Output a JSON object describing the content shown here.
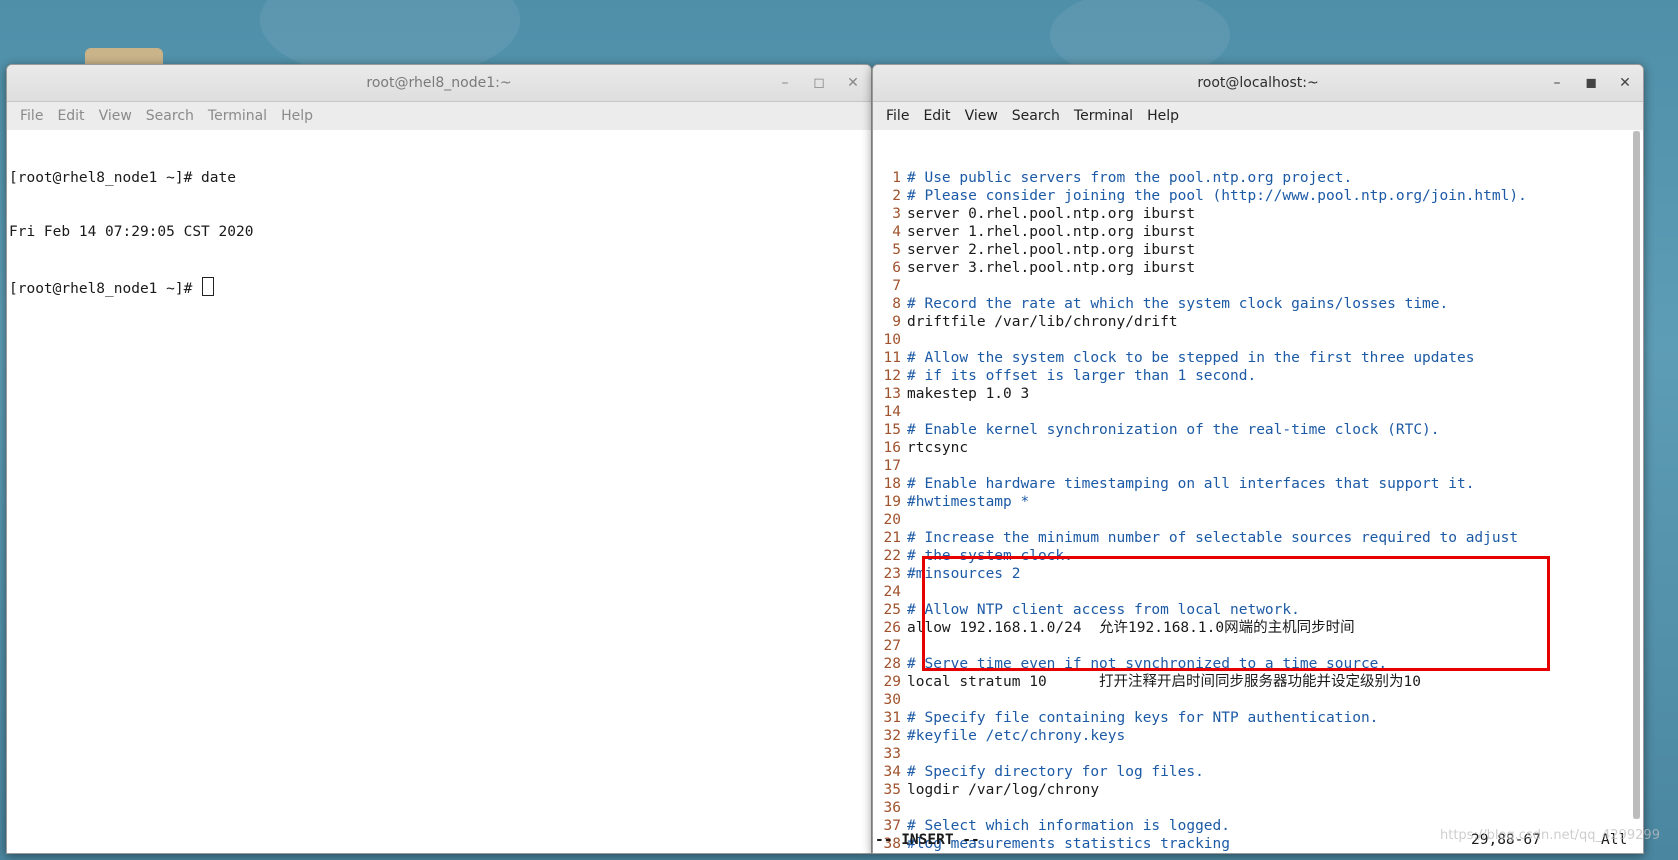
{
  "left_window": {
    "title": "root@rhel8_node1:~",
    "menu": [
      "File",
      "Edit",
      "View",
      "Search",
      "Terminal",
      "Help"
    ],
    "lines": [
      "[root@rhel8_node1 ~]# date",
      "Fri Feb 14 07:29:05 CST 2020"
    ],
    "prompt": "[root@rhel8_node1 ~]# "
  },
  "right_window": {
    "title": "root@localhost:~",
    "menu": [
      "File",
      "Edit",
      "View",
      "Search",
      "Terminal",
      "Help"
    ],
    "lines": [
      {
        "n": "1",
        "t": "# Use public servers from the pool.ntp.org project.",
        "comment": true
      },
      {
        "n": "2",
        "t": "# Please consider joining the pool (http://www.pool.ntp.org/join.html).",
        "comment": true
      },
      {
        "n": "3",
        "t": "server 0.rhel.pool.ntp.org iburst",
        "comment": false
      },
      {
        "n": "4",
        "t": "server 1.rhel.pool.ntp.org iburst",
        "comment": false
      },
      {
        "n": "5",
        "t": "server 2.rhel.pool.ntp.org iburst",
        "comment": false
      },
      {
        "n": "6",
        "t": "server 3.rhel.pool.ntp.org iburst",
        "comment": false
      },
      {
        "n": "7",
        "t": "",
        "comment": false
      },
      {
        "n": "8",
        "t": "# Record the rate at which the system clock gains/losses time.",
        "comment": true
      },
      {
        "n": "9",
        "t": "driftfile /var/lib/chrony/drift",
        "comment": false
      },
      {
        "n": "10",
        "t": "",
        "comment": false
      },
      {
        "n": "11",
        "t": "# Allow the system clock to be stepped in the first three updates",
        "comment": true
      },
      {
        "n": "12",
        "t": "# if its offset is larger than 1 second.",
        "comment": true
      },
      {
        "n": "13",
        "t": "makestep 1.0 3",
        "comment": false
      },
      {
        "n": "14",
        "t": "",
        "comment": false
      },
      {
        "n": "15",
        "t": "# Enable kernel synchronization of the real-time clock (RTC).",
        "comment": true
      },
      {
        "n": "16",
        "t": "rtcsync",
        "comment": false
      },
      {
        "n": "17",
        "t": "",
        "comment": false
      },
      {
        "n": "18",
        "t": "# Enable hardware timestamping on all interfaces that support it.",
        "comment": true
      },
      {
        "n": "19",
        "t": "#hwtimestamp *",
        "comment": true
      },
      {
        "n": "20",
        "t": "",
        "comment": false
      },
      {
        "n": "21",
        "t": "# Increase the minimum number of selectable sources required to adjust",
        "comment": true
      },
      {
        "n": "22",
        "t": "# the system clock.",
        "comment": true
      },
      {
        "n": "23",
        "t": "#minsources 2",
        "comment": true
      },
      {
        "n": "24",
        "t": "",
        "comment": false
      },
      {
        "n": "25",
        "t": "# Allow NTP client access from local network.",
        "comment": true
      },
      {
        "n": "26",
        "t": "allow 192.168.1.0/24  允许192.168.1.0网端的主机同步时间",
        "comment": false
      },
      {
        "n": "27",
        "t": "",
        "comment": false
      },
      {
        "n": "28",
        "t": "# Serve time even if not synchronized to a time source.",
        "comment": true
      },
      {
        "n": "29",
        "t": "local stratum 10      打开注释开启时间同步服务器功能并设定级别为10",
        "comment": false
      },
      {
        "n": "30",
        "t": "",
        "comment": false
      },
      {
        "n": "31",
        "t": "# Specify file containing keys for NTP authentication.",
        "comment": true
      },
      {
        "n": "32",
        "t": "#keyfile /etc/chrony.keys",
        "comment": true
      },
      {
        "n": "33",
        "t": "",
        "comment": false
      },
      {
        "n": "34",
        "t": "# Specify directory for log files.",
        "comment": true
      },
      {
        "n": "35",
        "t": "logdir /var/log/chrony",
        "comment": false
      },
      {
        "n": "36",
        "t": "",
        "comment": false
      },
      {
        "n": "37",
        "t": "# Select which information is logged.",
        "comment": true
      },
      {
        "n": "38",
        "t": "#log measurements statistics tracking",
        "comment": true
      }
    ],
    "tilde": "~",
    "status": {
      "mode": "-- INSERT --",
      "position": "29,88-67",
      "percent": "All"
    }
  },
  "watermark": "https://blog.csdn.net/qq_4299299"
}
